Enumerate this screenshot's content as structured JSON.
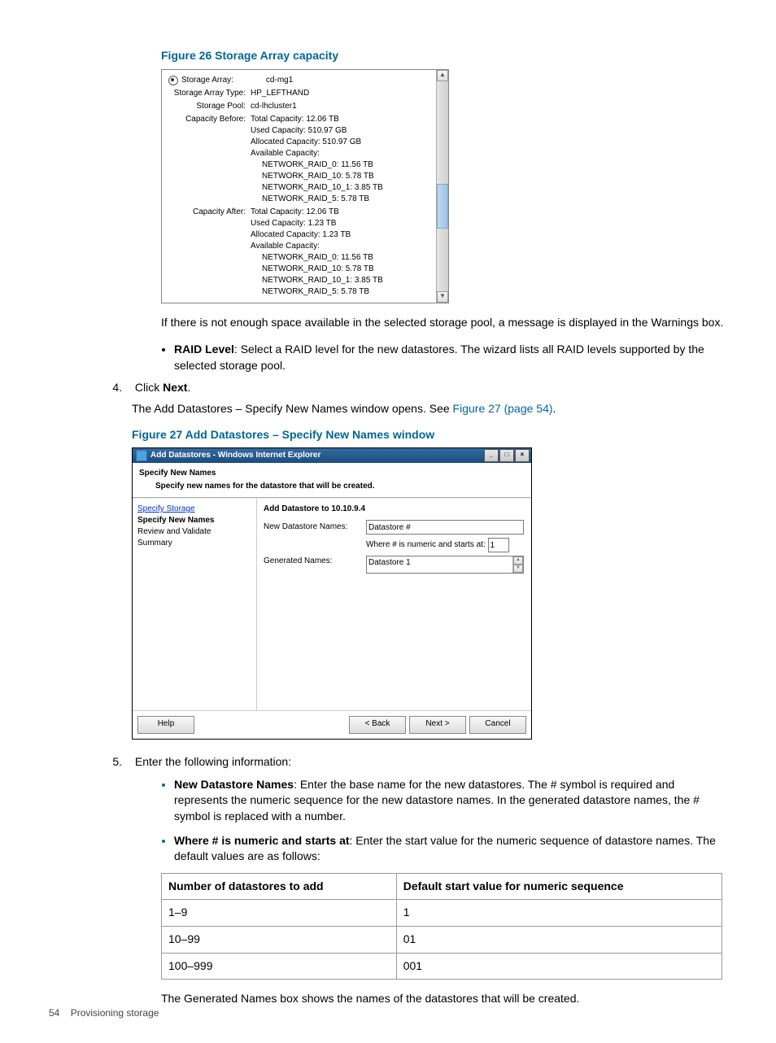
{
  "figure26": {
    "caption": "Figure 26 Storage Array capacity",
    "rows": {
      "storage_array_label": "Storage Array:",
      "storage_array_value": "cd-mg1",
      "storage_array_type_label": "Storage Array Type:",
      "storage_array_type_value": "HP_LEFTHAND",
      "storage_pool_label": "Storage Pool:",
      "storage_pool_value": "cd-lhcluster1",
      "capacity_before_label": "Capacity Before:",
      "capacity_before_total": "Total Capacity: 12.06 TB",
      "capacity_before_used": "Used Capacity: 510.97 GB",
      "capacity_before_alloc": "Allocated Capacity: 510.97 GB",
      "capacity_before_avail": "Available Capacity:",
      "capacity_before_r0": "NETWORK_RAID_0: 11.56 TB",
      "capacity_before_r10": "NETWORK_RAID_10: 5.78 TB",
      "capacity_before_r101": "NETWORK_RAID_10_1: 3.85 TB",
      "capacity_before_r5": "NETWORK_RAID_5: 5.78 TB",
      "capacity_after_label": "Capacity After:",
      "capacity_after_total": "Total Capacity: 12.06 TB",
      "capacity_after_used": "Used Capacity: 1.23 TB",
      "capacity_after_alloc": "Allocated Capacity: 1.23 TB",
      "capacity_after_avail": "Available Capacity:",
      "capacity_after_r0": "NETWORK_RAID_0: 11.56 TB",
      "capacity_after_r10": "NETWORK_RAID_10: 5.78 TB",
      "capacity_after_r101": "NETWORK_RAID_10_1: 3.85 TB",
      "capacity_after_r5": "NETWORK_RAID_5: 5.78 TB"
    }
  },
  "para_warning": "If there is not enough space available in the selected storage pool, a message is displayed in the Warnings box.",
  "raid_bullet_bold": "RAID Level",
  "raid_bullet_text": ": Select a RAID level for the new datastores. The wizard lists all RAID levels supported by the selected storage pool.",
  "step4_num": "4.",
  "step4_text_pre": "Click ",
  "step4_text_bold": "Next",
  "step4_text_post": ".",
  "step4_sub": "The Add Datastores – Specify New Names window opens. See ",
  "step4_link": "Figure 27 (page 54)",
  "step4_sub_post": ".",
  "figure27_caption": "Figure 27 Add Datastores – Specify New Names window",
  "fig27": {
    "title": "Add Datastores - Windows Internet Explorer",
    "header": "Specify New Names",
    "subheader": "Specify new names for the datastore that will be created.",
    "nav": {
      "specify_storage": "Specify Storage",
      "specify_new_names": "Specify New Names",
      "review": "Review and Validate",
      "summary": "Summary"
    },
    "content": {
      "sectitle": "Add Datastore to 10.10.9.4",
      "new_names_label": "New Datastore Names:",
      "new_names_value": "Datastore #",
      "where_label_pre": "Where # is numeric and starts at:",
      "where_value": "1",
      "generated_label": "Generated Names:",
      "generated_value": "Datastore 1"
    },
    "buttons": {
      "help": "Help",
      "back": "< Back",
      "next": "Next >",
      "cancel": "Cancel"
    }
  },
  "step5_num": "5.",
  "step5_text": "Enter the following information:",
  "bullets5": {
    "a_bold": "New Datastore Names",
    "a_text": ": Enter the base name for the new datastores. The # symbol is required and represents the numeric sequence for the new datastore names. In the generated datastore names, the # symbol is replaced with a number.",
    "b_bold": "Where # is numeric and starts at",
    "b_text": ": Enter the start value for the numeric sequence of datastore names. The default values are as follows:"
  },
  "table": {
    "h1": "Number of datastores to add",
    "h2": "Default start value for numeric sequence",
    "r1c1": "1–9",
    "r1c2": "1",
    "r2c1": "10–99",
    "r2c2": "01",
    "r3c1": "100–999",
    "r3c2": "001"
  },
  "gen_names_para": "The Generated Names box shows the names of the datastores that will be created.",
  "footer_page": "54",
  "footer_title": "Provisioning storage"
}
